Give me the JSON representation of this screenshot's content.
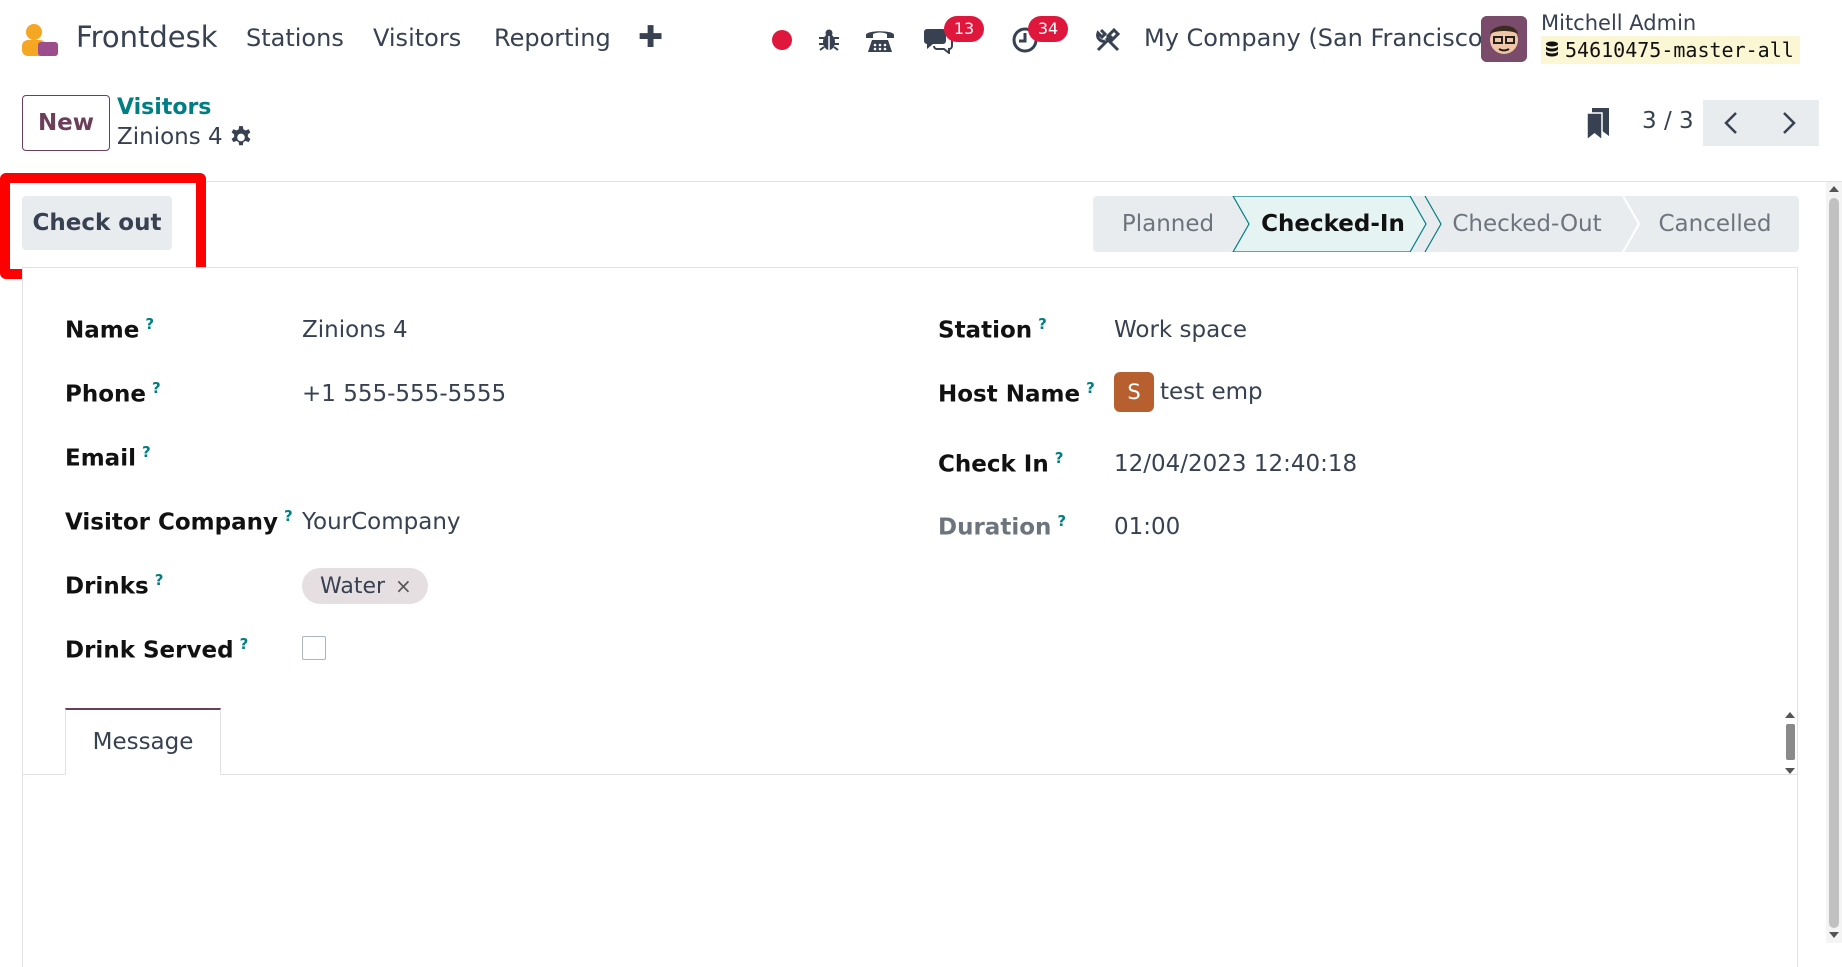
{
  "navbar": {
    "app_name": "Frontdesk",
    "menu": [
      "Stations",
      "Visitors",
      "Reporting"
    ],
    "add_icon": "plus-icon",
    "messages_count": "13",
    "activities_count": "34",
    "company": "My Company (San Francisco)",
    "user_name": "Mitchell Admin",
    "db_name": "54610475-master-all"
  },
  "control_panel": {
    "new_label": "New",
    "breadcrumb_parent": "Visitors",
    "breadcrumb_current": "Zinions 4",
    "pager_value": "3 / 3"
  },
  "statusbar": {
    "action_label": "Check out",
    "stages": [
      "Planned",
      "Checked-In",
      "Checked-Out",
      "Cancelled"
    ],
    "active_stage": "Checked-In"
  },
  "form": {
    "left": {
      "name_label": "Name",
      "name_value": "Zinions 4",
      "phone_label": "Phone",
      "phone_value": "+1 555-555-5555",
      "email_label": "Email",
      "email_value": "",
      "company_label": "Visitor Company",
      "company_value": "YourCompany",
      "drinks_label": "Drinks",
      "drink_tag": "Water",
      "drink_tag_remove": "×",
      "served_label": "Drink Served"
    },
    "right": {
      "station_label": "Station",
      "station_value": "Work space",
      "host_label": "Host Name",
      "host_initial": "S",
      "host_value": "test emp",
      "checkin_label": "Check In",
      "checkin_value": "12/04/2023 12:40:18",
      "duration_label": "Duration",
      "duration_value": "01:00"
    },
    "help_marker": "?",
    "tab_label": "Message"
  },
  "colors": {
    "brand": "#6b3f5a",
    "teal": "#017e84",
    "badge": "#e0173d",
    "highlight": "#ff0000"
  }
}
